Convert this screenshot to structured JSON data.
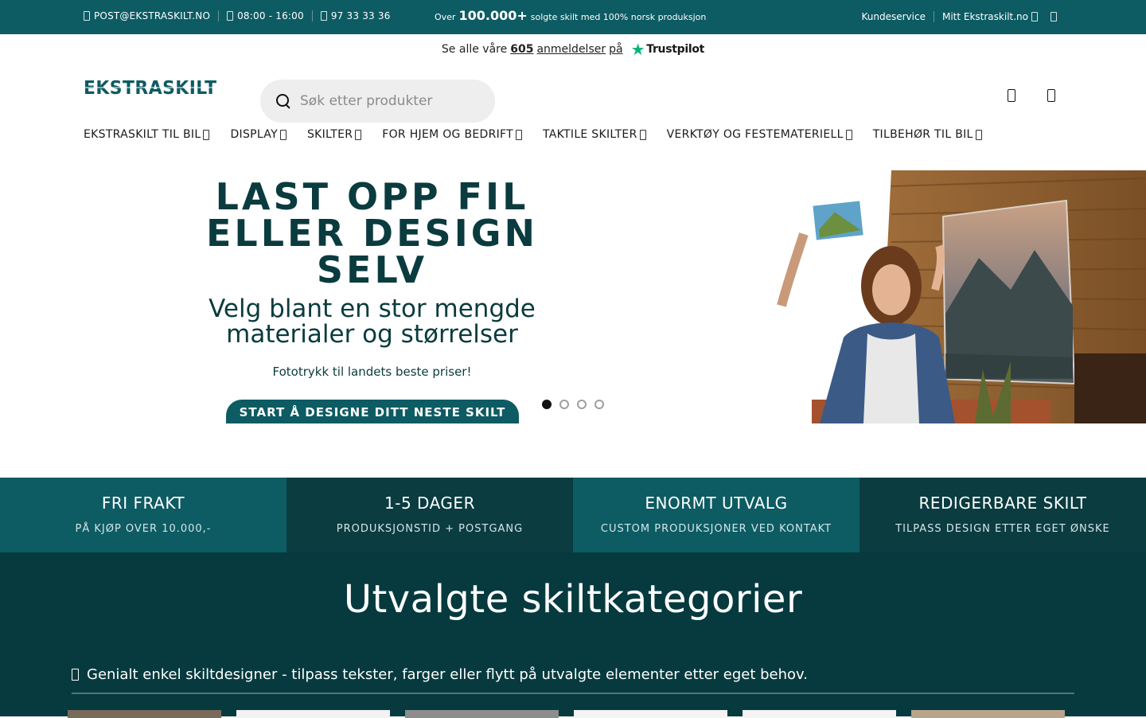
{
  "topbar": {
    "email": "POST@EKSTRASKILT.NO",
    "hours": "08:00 - 16:00",
    "phone": "97 33 33 36",
    "promo_prefix": "Over",
    "promo_number": "100.000+",
    "promo_suffix": "solgte skilt med 100% norsk produksjon",
    "customer_service": "Kundeservice",
    "my_account": "Mitt Ekstraskilt.no"
  },
  "trustbar": {
    "prefix": "Se alle våre",
    "count": "605",
    "reviews": "anmeldelser",
    "on": "på",
    "brand": "Trustpilot"
  },
  "header": {
    "logo": "EKSTRASKILT",
    "search_placeholder": "Søk etter produkter"
  },
  "nav": {
    "items": [
      "EKSTRASKILT TIL BIL",
      "DISPLAY",
      "SKILTER",
      "FOR HJEM OG BEDRIFT",
      "TAKTILE SKILTER",
      "VERKTØY OG FESTEMATERIELL",
      "TILBEHØR TIL BIL"
    ]
  },
  "hero": {
    "title_line1": "LAST OPP FIL",
    "title_line2": "ELLER DESIGN",
    "title_line3": "SELV",
    "subtitle_line1": "Velg blant en stor mengde",
    "subtitle_line2": "materialer og størrelser",
    "tagline": "Fototrykk til landets beste priser!",
    "cta": "START Å DESIGNE DITT NESTE SKILT",
    "slides_total": 4,
    "slide_active": 1
  },
  "usp": [
    {
      "title": "FRI FRAKT",
      "text": "PÅ KJØP OVER 10.000,-"
    },
    {
      "title": "1-5 DAGER",
      "text": "PRODUKSJONSTID + POSTGANG"
    },
    {
      "title": "ENORMT UTVALG",
      "text": "CUSTOM PRODUKSJONER VED KONTAKT"
    },
    {
      "title": "REDIGERBARE SKILT",
      "text": "TILPASS DESIGN ETTER EGET ØNSKE"
    }
  ],
  "categories": {
    "heading": "Utvalgte skiltkategorier",
    "note": "Genialt enkel skiltdesigner - tilpass tekster, farger eller flytt på utvalgte elementer etter eget behov."
  },
  "colors": {
    "brand": "#0d5b63",
    "brand_dark": "#063a3e",
    "trustpilot_green": "#00b67a"
  }
}
